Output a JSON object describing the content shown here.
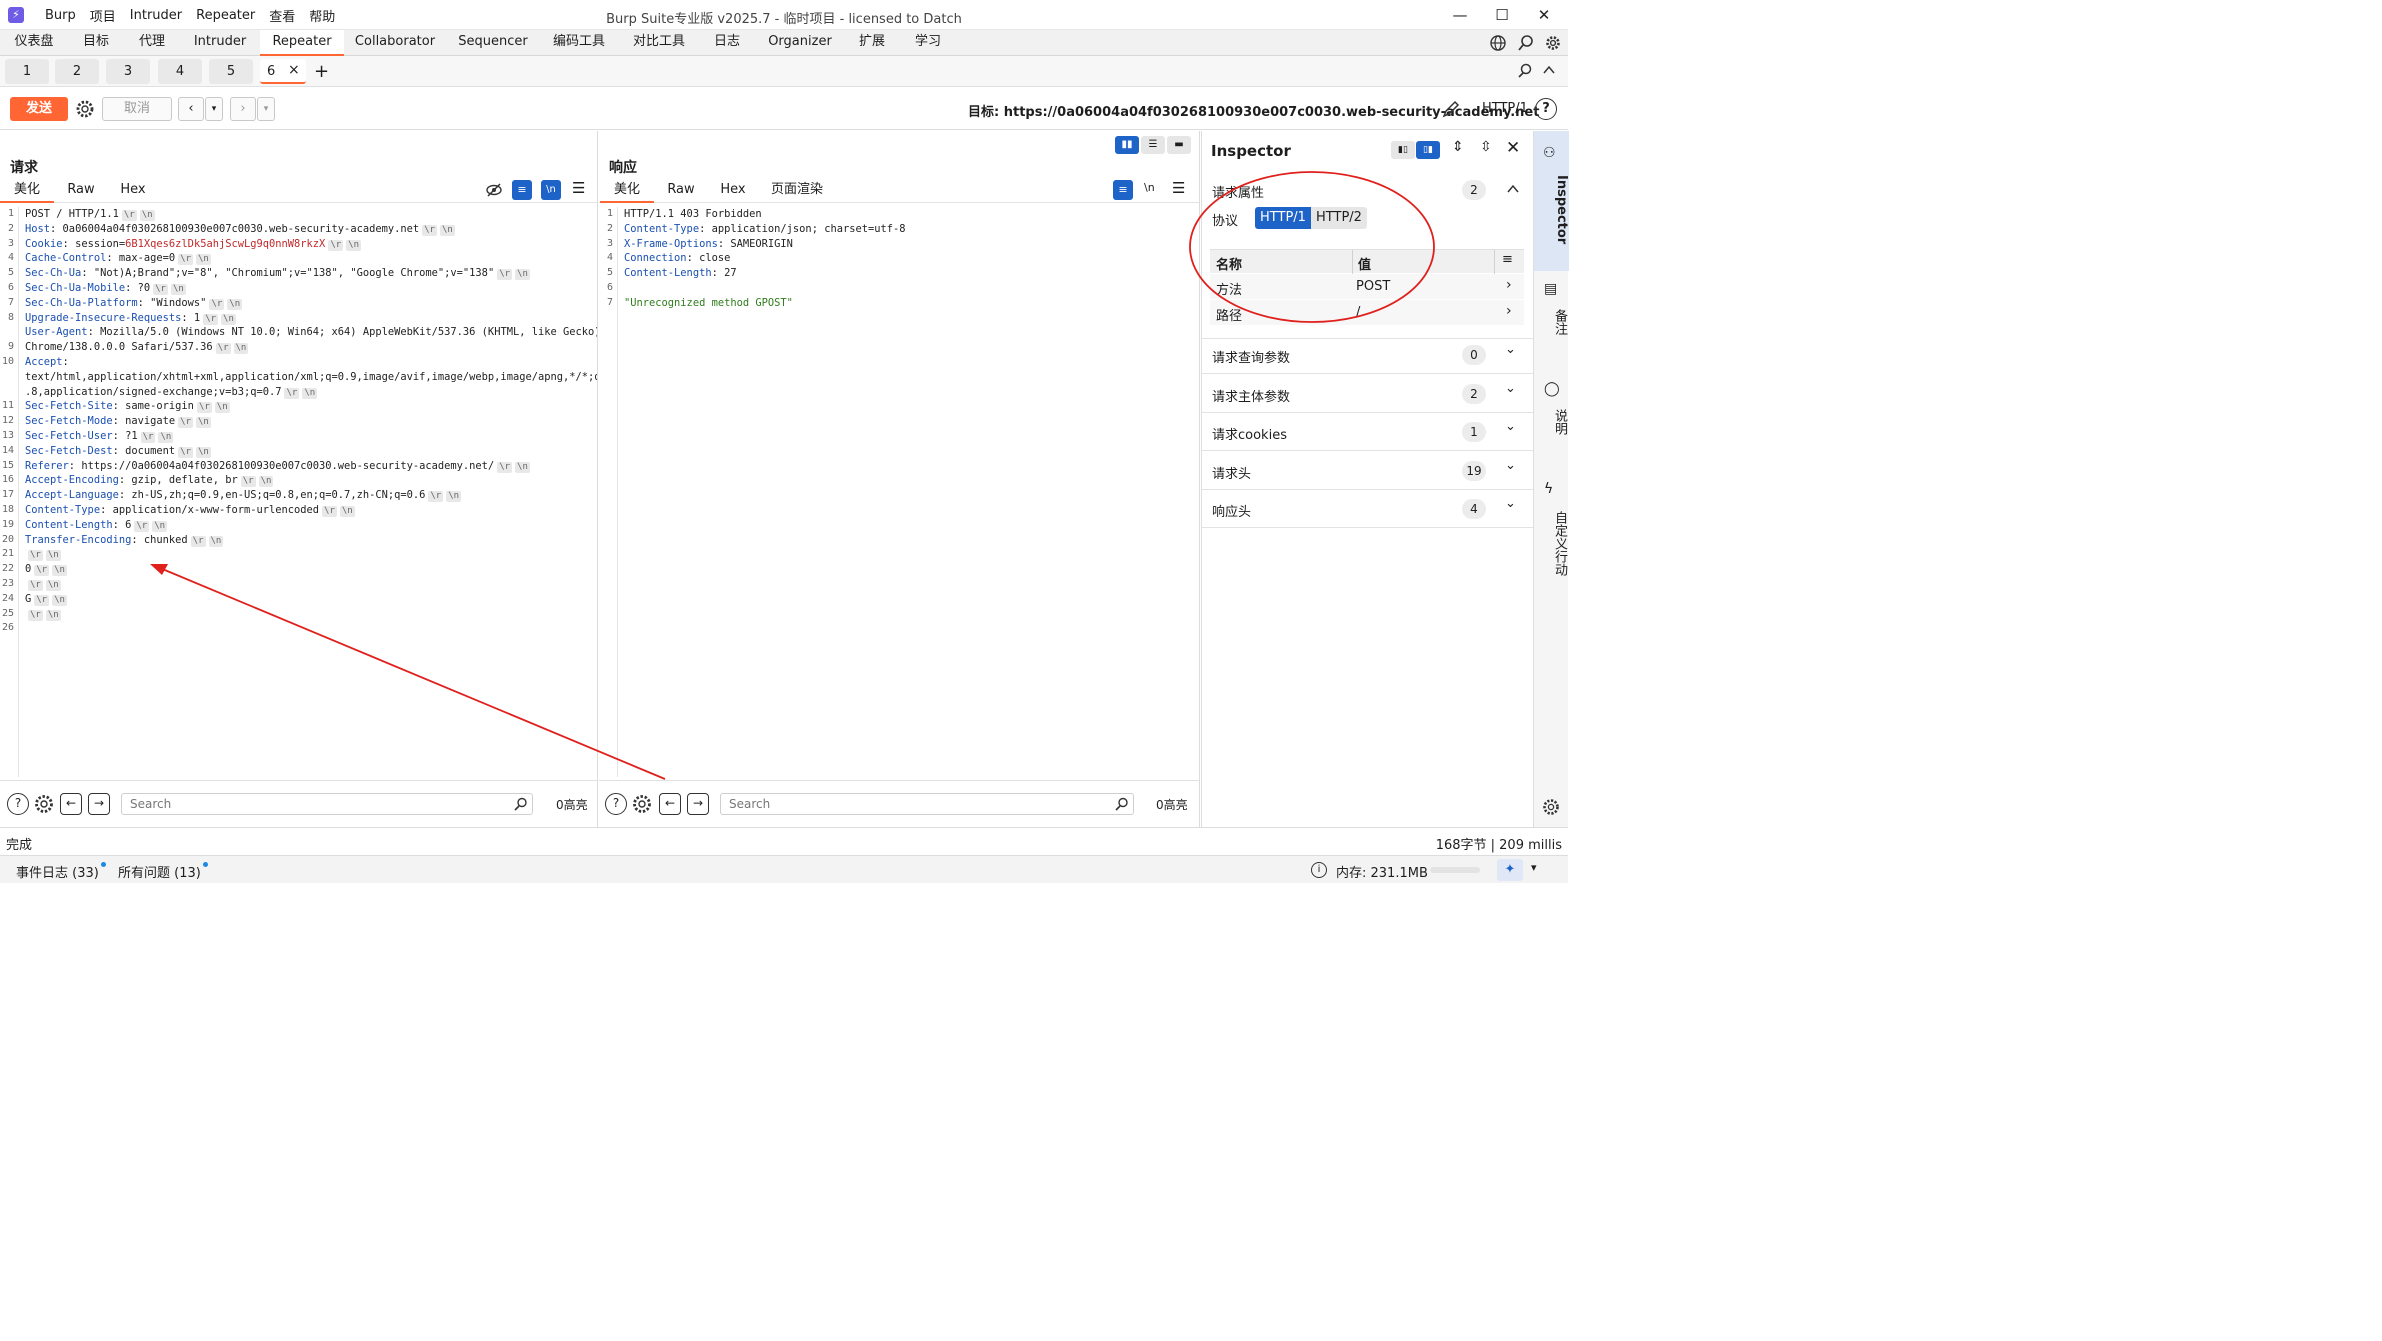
{
  "app": {
    "logo": "⚡",
    "menu": [
      "Burp",
      "项目",
      "Intruder",
      "Repeater",
      "查看",
      "帮助"
    ],
    "title": "Burp Suite专业版  v2025.7 - 临时项目 - licensed to Datch",
    "controls": [
      "—",
      "☐",
      "✕"
    ]
  },
  "nav_tabs": [
    "仪表盘",
    "目标",
    "代理",
    "Intruder",
    "Repeater",
    "Collaborator",
    "Sequencer",
    "编码工具",
    "对比工具",
    "日志",
    "Organizer",
    "扩展",
    "学习"
  ],
  "nav_active": "Repeater",
  "repeater_tabs": [
    "1",
    "2",
    "3",
    "4",
    "5",
    "6"
  ],
  "repeater_active": "6",
  "toolbar": {
    "send": "发送",
    "cancel": "取消",
    "target": "目标: https://0a06004a04f030268100930e007c0030.web-security-academy.net",
    "protocol": "HTTP/1"
  },
  "request": {
    "title": "请求",
    "tabs": [
      "美化",
      "Raw",
      "Hex"
    ],
    "line_numbers": [
      "1",
      "2",
      "3",
      "4",
      "5",
      "6",
      "7",
      "8",
      "",
      "9",
      "10",
      "",
      "",
      "11",
      "12",
      "13",
      "14",
      "15",
      "16",
      "17",
      "18",
      "19",
      "20",
      "21",
      "22",
      "23",
      "24",
      "25",
      "26"
    ],
    "lines": [
      {
        "n": "",
        "v": "POST / HTTP/1.1",
        "crlf": true
      },
      {
        "n": "Host",
        "v": " 0a06004a04f030268100930e007c0030.web-security-academy.net",
        "crlf": true
      },
      {
        "n": "Cookie",
        "v": " session=",
        "cookie": "6B1Xqes6zlDk5ahjScwLg9q0nnW8rkzX",
        "crlf": true
      },
      {
        "n": "Cache-Control",
        "v": " max-age=0",
        "crlf": true
      },
      {
        "n": "Sec-Ch-Ua",
        "v": " \"Not)A;Brand\";v=\"8\", \"Chromium\";v=\"138\", \"Google Chrome\";v=\"138\"",
        "crlf": true
      },
      {
        "n": "Sec-Ch-Ua-Mobile",
        "v": " ?0",
        "crlf": true
      },
      {
        "n": "Sec-Ch-Ua-Platform",
        "v": " \"Windows\"",
        "crlf": true
      },
      {
        "n": "Upgrade-Insecure-Requests",
        "v": " 1",
        "crlf": true
      },
      {
        "n": "User-Agent",
        "v": " Mozilla/5.0 (Windows NT 10.0; Win64; x64) AppleWebKit/537.36 (KHTML, like Gecko)",
        "crlf": false
      },
      {
        "n": "",
        "v": "Chrome/138.0.0.0 Safari/537.36",
        "crlf": true
      },
      {
        "n": "Accept",
        "v": "",
        "crlf": false
      },
      {
        "n": "",
        "v": "text/html,application/xhtml+xml,application/xml;q=0.9,image/avif,image/webp,image/apng,*/*;q=0",
        "crlf": false
      },
      {
        "n": "",
        "v": ".8,application/signed-exchange;v=b3;q=0.7",
        "crlf": true
      },
      {
        "n": "Sec-Fetch-Site",
        "v": " same-origin",
        "crlf": true
      },
      {
        "n": "Sec-Fetch-Mode",
        "v": " navigate",
        "crlf": true
      },
      {
        "n": "Sec-Fetch-User",
        "v": " ?1",
        "crlf": true
      },
      {
        "n": "Sec-Fetch-Dest",
        "v": " document",
        "crlf": true
      },
      {
        "n": "Referer",
        "v": " https://0a06004a04f030268100930e007c0030.web-security-academy.net/",
        "crlf": true
      },
      {
        "n": "Accept-Encoding",
        "v": " gzip, deflate, br",
        "crlf": true
      },
      {
        "n": "Accept-Language",
        "v": " zh-US,zh;q=0.9,en-US;q=0.8,en;q=0.7,zh-CN;q=0.6",
        "crlf": true
      },
      {
        "n": "Content-Type",
        "v": " application/x-www-form-urlencoded",
        "crlf": true
      },
      {
        "n": "Content-Length",
        "v": " 6",
        "crlf": true
      },
      {
        "n": "Transfer-Encoding",
        "v": " chunked",
        "crlf": true
      },
      {
        "n": "",
        "v": "",
        "crlf": true
      },
      {
        "n": "",
        "v": "0",
        "crlf": true
      },
      {
        "n": "",
        "v": "",
        "crlf": true
      },
      {
        "n": "",
        "v": "G",
        "crlf": true
      },
      {
        "n": "",
        "v": "",
        "crlf": true
      },
      {
        "n": "",
        "v": "",
        "crlf": false
      }
    ]
  },
  "response": {
    "title": "响应",
    "tabs": [
      "美化",
      "Raw",
      "Hex",
      "页面渲染"
    ],
    "line_numbers": [
      "1",
      "2",
      "3",
      "4",
      "5",
      "6",
      "7"
    ],
    "lines": [
      {
        "n": "",
        "v": "HTTP/1.1 403 Forbidden"
      },
      {
        "n": "Content-Type",
        "v": " application/json; charset=utf-8"
      },
      {
        "n": "X-Frame-Options",
        "v": " SAMEORIGIN"
      },
      {
        "n": "Connection",
        "v": " close"
      },
      {
        "n": "Content-Length",
        "v": " 27"
      },
      {
        "n": "",
        "v": ""
      },
      {
        "n": "",
        "v": "\"Unrecognized method GPOST\"",
        "str": true
      }
    ]
  },
  "search": {
    "placeholder": "Search",
    "highlights": "0高亮"
  },
  "inspector": {
    "title": "Inspector",
    "attr_section": "请求属性",
    "attr_count": "2",
    "protocol_label": "协议",
    "protocols": [
      "HTTP/1",
      "HTTP/2"
    ],
    "table_headers": [
      "名称",
      "值"
    ],
    "rows": [
      {
        "name": "方法",
        "value": "POST"
      },
      {
        "name": "路径",
        "value": "/"
      }
    ],
    "sections": [
      {
        "label": "请求查询参数",
        "count": "0"
      },
      {
        "label": "请求主体参数",
        "count": "2"
      },
      {
        "label": "请求cookies",
        "count": "1"
      },
      {
        "label": "请求头",
        "count": "19"
      },
      {
        "label": "响应头",
        "count": "4"
      }
    ]
  },
  "side_tabs": [
    "Inspector",
    "备注",
    "说明",
    "自定义行动"
  ],
  "status": {
    "left": "完成",
    "right": "168字节 | 209 millis"
  },
  "bottom": {
    "events": "事件日志 (33)",
    "issues": "所有问题 (13)",
    "memory": "内存: 231.1MB"
  },
  "colors": {
    "accent": "#ff6633",
    "annotation": "#e0201c",
    "blue": "#1e63c8"
  }
}
